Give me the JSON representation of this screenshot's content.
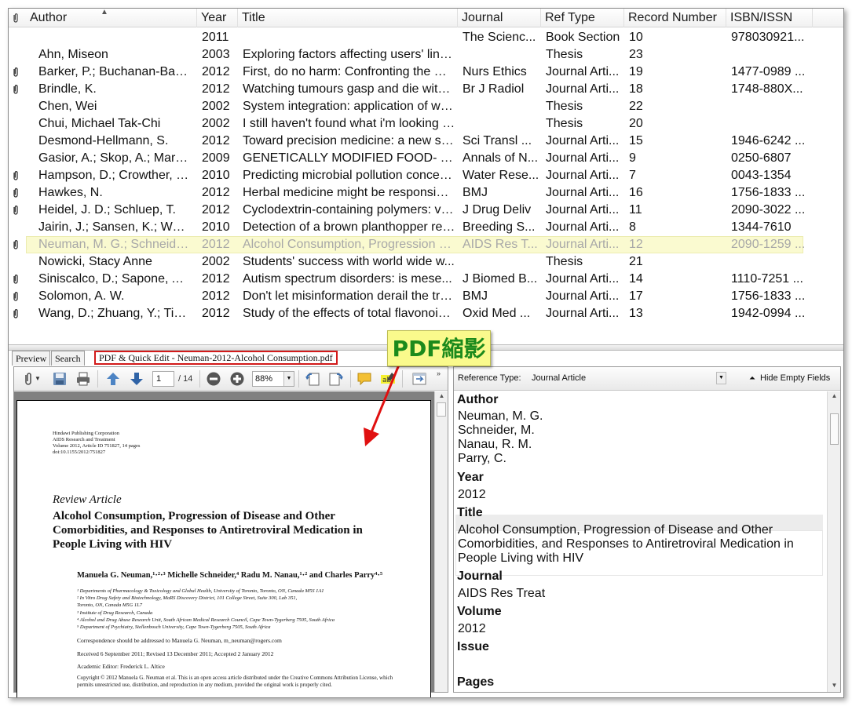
{
  "columns": [
    "Author",
    "Year",
    "Title",
    "Journal",
    "Ref Type",
    "Record Number",
    "ISBN/ISSN"
  ],
  "rows": [
    {
      "attach": false,
      "author": "",
      "year": "2011",
      "title": "",
      "journal": "The Scienc...",
      "reftype": "Book Section",
      "record": "10",
      "isbn": "978030921..."
    },
    {
      "attach": false,
      "author": "Ahn, Miseon",
      "year": "2003",
      "title": "Exploring factors affecting users' link-...",
      "journal": "",
      "reftype": "Thesis",
      "record": "23",
      "isbn": ""
    },
    {
      "attach": true,
      "author": "Barker, P.; Buchanan-Bark...",
      "year": "2012",
      "title": "First, do no harm: Confronting the my...",
      "journal": "Nurs Ethics",
      "reftype": "Journal Arti...",
      "record": "19",
      "isbn": "1477-0989 ..."
    },
    {
      "attach": true,
      "author": "Brindle, K.",
      "year": "2012",
      "title": "Watching tumours gasp and die with ...",
      "journal": "Br J Radiol",
      "reftype": "Journal Arti...",
      "record": "18",
      "isbn": "1748-880X..."
    },
    {
      "attach": false,
      "author": "Chen, Wei",
      "year": "2002",
      "title": "System integration: application of we...",
      "journal": "",
      "reftype": "Thesis",
      "record": "22",
      "isbn": ""
    },
    {
      "attach": false,
      "author": "Chui, Michael Tak-Chi",
      "year": "2002",
      "title": "I still haven't found what i'm looking fo...",
      "journal": "",
      "reftype": "Thesis",
      "record": "20",
      "isbn": ""
    },
    {
      "attach": false,
      "author": "Desmond-Hellmann, S.",
      "year": "2012",
      "title": "Toward precision medicine: a new so...",
      "journal": "Sci Transl ...",
      "reftype": "Journal Arti...",
      "record": "15",
      "isbn": "1946-6242 ..."
    },
    {
      "attach": false,
      "author": "Gasior, A.; Skop, A.; Marci...",
      "year": "2009",
      "title": "GENETICALLY MODIFIED FOOD- T...",
      "journal": "Annals of N...",
      "reftype": "Journal Arti...",
      "record": "9",
      "isbn": "0250-6807"
    },
    {
      "attach": true,
      "author": "Hampson, D.; Crowther, J....",
      "year": "2010",
      "title": "Predicting microbial pollution concen...",
      "journal": "Water Rese...",
      "reftype": "Journal Arti...",
      "record": "7",
      "isbn": "0043-1354"
    },
    {
      "attach": true,
      "author": "Hawkes, N.",
      "year": "2012",
      "title": "Herbal medicine might be responsibl...",
      "journal": "BMJ",
      "reftype": "Journal Arti...",
      "record": "16",
      "isbn": "1756-1833 ..."
    },
    {
      "attach": true,
      "author": "Heidel, J. D.; Schluep, T.",
      "year": "2012",
      "title": "Cyclodextrin-containing polymers: ve...",
      "journal": "J Drug Deliv",
      "reftype": "Journal Arti...",
      "record": "11",
      "isbn": "2090-3022 ..."
    },
    {
      "attach": false,
      "author": "Jairin, J.; Sansen, K.; Won...",
      "year": "2010",
      "title": "Detection of a brown planthopper res...",
      "journal": "Breeding S...",
      "reftype": "Journal Arti...",
      "record": "8",
      "isbn": "1344-7610"
    },
    {
      "attach": true,
      "selected": true,
      "author": "Neuman, M. G.; Schneider...",
      "year": "2012",
      "title": "Alcohol Consumption, Progression o...",
      "journal": "AIDS Res T...",
      "reftype": "Journal Arti...",
      "record": "12",
      "isbn": "2090-1259 ..."
    },
    {
      "attach": false,
      "author": "Nowicki, Stacy Anne",
      "year": "2002",
      "title": "Students' success with world wide w...",
      "journal": "",
      "reftype": "Thesis",
      "record": "21",
      "isbn": ""
    },
    {
      "attach": true,
      "author": "Siniscalco, D.; Sapone, A....",
      "year": "2012",
      "title": "Autism spectrum disorders: is mese...",
      "journal": "J Biomed B...",
      "reftype": "Journal Arti...",
      "record": "14",
      "isbn": "1110-7251 ..."
    },
    {
      "attach": true,
      "author": "Solomon, A. W.",
      "year": "2012",
      "title": "Don't let misinformation derail the tra...",
      "journal": "BMJ",
      "reftype": "Journal Arti...",
      "record": "17",
      "isbn": "1756-1833 ..."
    },
    {
      "attach": true,
      "author": "Wang, D.; Zhuang, Y.; Tian,...",
      "year": "2012",
      "title": "Study of the effects of total flavonoids ...",
      "journal": "Oxid Med ...",
      "reftype": "Journal Arti...",
      "record": "13",
      "isbn": "1942-0994 ..."
    }
  ],
  "tabs": {
    "preview": "Preview",
    "search": "Search",
    "pdf": "PDF & Quick Edit - Neuman-2012-Alcohol Consumption.pdf"
  },
  "pdf_toolbar": {
    "page": "1",
    "total": "/ 14",
    "zoom": "88%"
  },
  "pdf_page": {
    "publisher": "Hindawi Publishing Corporation",
    "journal": "AIDS Research and Treatment",
    "volume": "Volume 2012, Article ID 751827, 14 pages",
    "doi": "doi:10.1155/2012/751827",
    "section": "Review Article",
    "title": "Alcohol Consumption, Progression of Disease and Other Comorbidities, and Responses to Antiretroviral Medication in People Living with HIV",
    "authors": "Manuela G. Neuman,¹·²·³ Michelle Schneider,⁴ Radu M. Nanau,¹·² and Charles Parry⁴·⁵",
    "affiliations": [
      "¹ Departments of Pharmacology & Toxicology and Global Health, University of Toronto, Toronto, ON, Canada M5S 1A1",
      "² In Vitro Drug Safety and Biotechnology, MaRS Discovery District, 101 College Street, Suite 300, Lab 351,",
      "   Toronto, ON, Canada M5G 1L7",
      "³ Institute of Drug Research, Canada",
      "⁴ Alcohol and Drug Abuse Research Unit, South African Medical Research Council, Cape Town-Tygerberg 7505, South Africa",
      "⁵ Department of Psychiatry, Stellenbosch University, Cape Town-Tygerberg 7505, South Africa"
    ],
    "correspondence": "Correspondence should be addressed to Manuela G. Neuman, m_neuman@rogers.com",
    "received": "Received 6 September 2011; Revised 13 December 2011; Accepted 2 January 2012",
    "editor": "Academic Editor: Frederick L. Altice",
    "copyright": "Copyright © 2012 Manuela G. Neuman et al. This is an open access article distributed under the Creative Commons Attribution License, which permits unrestricted use, distribution, and reproduction in any medium, provided the original work is properly cited."
  },
  "callout": {
    "text": "PDF縮影",
    "color": "#1c8a1c",
    "background": "#fafa8c"
  },
  "ref_panel": {
    "reftype_label": "Reference Type:",
    "reftype_value": "Journal Article",
    "hide_empty": "Hide Empty Fields",
    "fields": {
      "author_label": "Author",
      "authors": [
        "Neuman, M. G.",
        "Schneider, M.",
        "Nanau, R. M.",
        "Parry, C."
      ],
      "year_label": "Year",
      "year": "2012",
      "title_label": "Title",
      "title_lines": [
        "Alcohol Consumption, Progression of Disease and Other",
        "Comorbidities, and Responses to Antiretroviral Medication in",
        "People Living with HIV"
      ],
      "journal_label": "Journal",
      "journal": "AIDS Res Treat",
      "volume_label": "Volume",
      "volume": "2012",
      "issue_label": "Issue",
      "issue": "",
      "pages_label": "Pages"
    }
  },
  "colors": {
    "selected_row": "#fafad0",
    "active_tab_border": "#d21a1a",
    "arrow": "#e01010"
  }
}
